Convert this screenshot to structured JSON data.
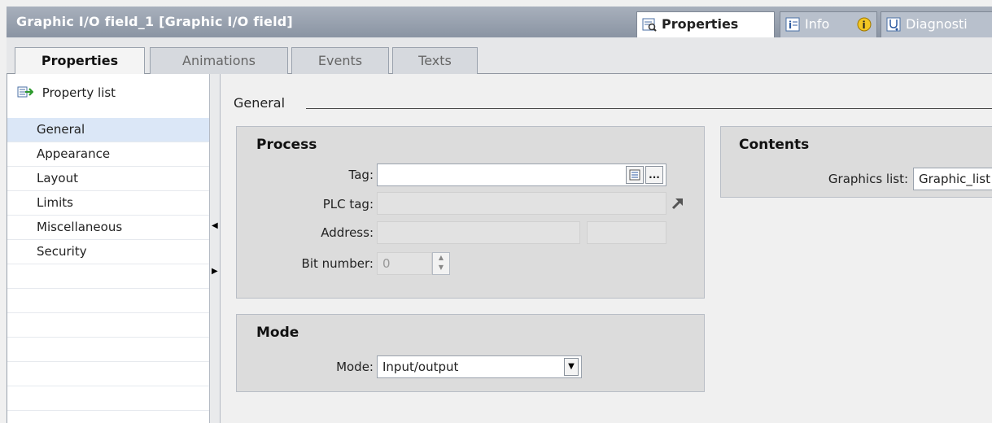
{
  "window": {
    "title": "Graphic I/O field_1 [Graphic I/O field]",
    "right_tabs": [
      {
        "label": "Properties"
      },
      {
        "label": "Info"
      },
      {
        "label": "Diagnosti"
      }
    ]
  },
  "tabs": [
    {
      "label": "Properties"
    },
    {
      "label": "Animations"
    },
    {
      "label": "Events"
    },
    {
      "label": "Texts"
    }
  ],
  "sidebar": {
    "header": "Property list",
    "items": [
      {
        "label": "General"
      },
      {
        "label": "Appearance"
      },
      {
        "label": "Layout"
      },
      {
        "label": "Limits"
      },
      {
        "label": "Miscellaneous"
      },
      {
        "label": "Security"
      }
    ]
  },
  "section": {
    "title": "General"
  },
  "process": {
    "title": "Process",
    "tag_label": "Tag:",
    "tag_value": "",
    "plc_tag_label": "PLC tag:",
    "address_label": "Address:",
    "bit_number_label": "Bit number:",
    "bit_number_value": "0",
    "browse_label": "..."
  },
  "mode": {
    "title": "Mode",
    "mode_label": "Mode:",
    "mode_value": "Input/output"
  },
  "contents": {
    "title": "Contents",
    "graphics_list_label": "Graphics list:",
    "graphics_list_value": "Graphic_list"
  },
  "colors": {
    "titlebar": "#8a94a3",
    "selected_item": "#dbe7f7",
    "group_bg": "#dcdcdc"
  }
}
